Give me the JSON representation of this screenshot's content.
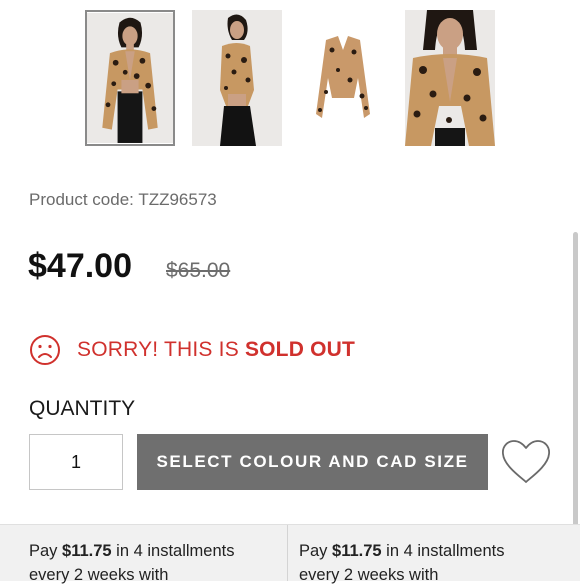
{
  "gallery": {
    "thumbnails": [
      {
        "alt": "leopard print tie front top - front view",
        "selected": true
      },
      {
        "alt": "leopard print tie front top - side view",
        "selected": false
      },
      {
        "alt": "leopard print tie front top - flat lay",
        "selected": false
      },
      {
        "alt": "leopard print tie front top - close up",
        "selected": false
      }
    ]
  },
  "product": {
    "code_label": "Product code: TZZ96573",
    "price": "$47.00",
    "original_price": "$65.00"
  },
  "stock": {
    "icon": "sad-face-icon",
    "message_prefix": "SORRY! THIS IS ",
    "message_emphasis": "SOLD OUT",
    "color": "#d0312d"
  },
  "quantity": {
    "label": "QUANTITY",
    "value": "1"
  },
  "actions": {
    "select_button_label": "SELECT COLOUR AND CAD SIZE",
    "button_color": "#6f6f6f",
    "wishlist_icon": "heart-icon"
  },
  "installments": [
    {
      "pre": "Pay ",
      "amount": "$11.75",
      "post": " in 4 installments",
      "line2": "every 2 weeks with"
    },
    {
      "pre": "Pay ",
      "amount": "$11.75",
      "post": " in 4 installments",
      "line2": "every 2 weeks with"
    }
  ]
}
